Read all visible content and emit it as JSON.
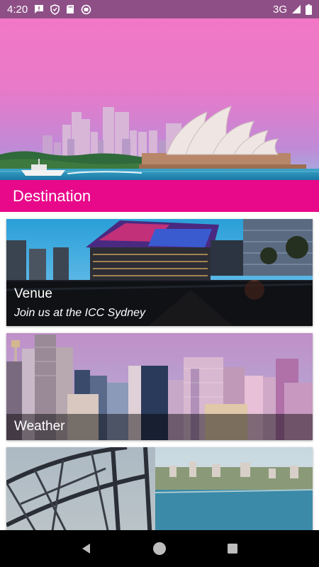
{
  "status_bar": {
    "time": "4:20",
    "network": "3G",
    "icons": [
      "message-icon",
      "shield-icon",
      "sd-card-icon",
      "media-icon",
      "signal-icon",
      "battery-icon"
    ]
  },
  "hero": {
    "image": "sydney-harbour-opera-house-image"
  },
  "title_bar": {
    "title": "Destination",
    "color": "#e8088a"
  },
  "cards": [
    {
      "title": "Venue",
      "subtitle": "Join us at the ICC Sydney",
      "image": "icc-sydney-image"
    },
    {
      "title": "Weather",
      "subtitle": "",
      "image": "sydney-skyline-image"
    },
    {
      "title": "",
      "subtitle": "",
      "image": "harbour-bridge-image"
    }
  ],
  "nav_bar": {
    "buttons": [
      "back-icon",
      "home-icon",
      "recents-icon"
    ]
  },
  "colors": {
    "status_bar": "#8e4f86",
    "accent": "#e8088a",
    "nav_bar": "#000000"
  }
}
